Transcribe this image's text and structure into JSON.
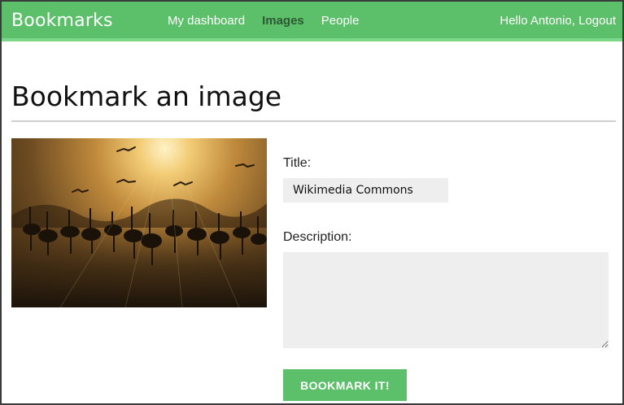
{
  "header": {
    "brand": "Bookmarks",
    "nav": [
      {
        "label": "My dashboard",
        "active": false
      },
      {
        "label": "Images",
        "active": true
      },
      {
        "label": "People",
        "active": false
      }
    ],
    "greeting": "Hello Antonio,",
    "logout_label": "Logout"
  },
  "page": {
    "title": "Bookmark an image"
  },
  "image": {
    "subject": "Flock of cranes silhouetted at sunrise"
  },
  "form": {
    "title_label": "Title:",
    "title_value": "Wikimedia Commons",
    "description_label": "Description:",
    "description_value": "",
    "submit_label": "BOOKMARK IT!"
  },
  "colors": {
    "accent": "#5cbf6a",
    "active_nav": "#2d5a34",
    "input_bg": "#eeeeee"
  }
}
